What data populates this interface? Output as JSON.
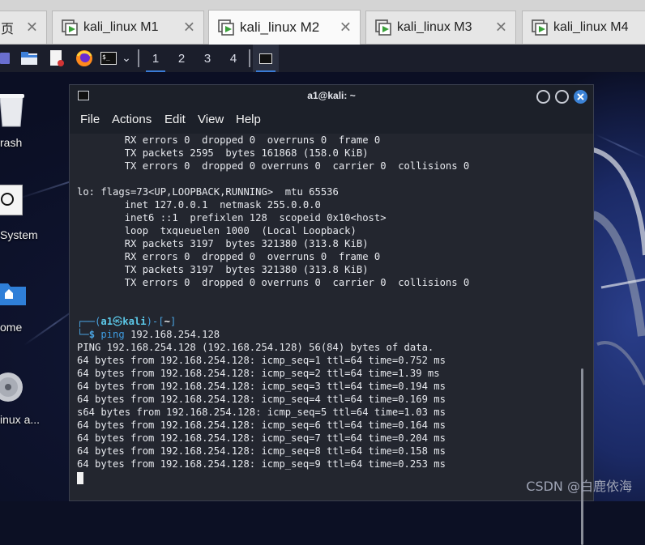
{
  "host_tabs": [
    {
      "label": "页",
      "close": "✕",
      "active": false
    },
    {
      "label": "kali_linux M1",
      "close": "✕",
      "active": false
    },
    {
      "label": "kali_linux M2",
      "close": "✕",
      "active": true
    },
    {
      "label": "kali_linux M3",
      "close": "✕",
      "active": false
    },
    {
      "label": "kali_linux M4",
      "close": "",
      "active": false
    }
  ],
  "taskbar": {
    "launchers": [
      "show-desktop-icon",
      "file-manager-icon",
      "text-editor-icon",
      "firefox-icon",
      "terminal-icon"
    ],
    "dropdown_glyph": "⌄",
    "workspaces": [
      "1",
      "2",
      "3",
      "4"
    ],
    "active_workspace": "1",
    "terminal_glyph": "$_"
  },
  "desktop_icons": [
    {
      "label": "rash",
      "icon": "trash-icon"
    },
    {
      "label": "System",
      "icon": "system-icon"
    },
    {
      "label": "ome",
      "icon": "home-folder-icon"
    },
    {
      "label": "inux a...",
      "icon": "disc-icon"
    }
  ],
  "terminal": {
    "title": "a1@kali: ~",
    "menu": [
      "File",
      "Actions",
      "Edit",
      "View",
      "Help"
    ],
    "lines_upper": [
      "        RX errors 0  dropped 0  overruns 0  frame 0",
      "        TX packets 2595  bytes 161868 (158.0 KiB)",
      "        TX errors 0  dropped 0 overruns 0  carrier 0  collisions 0",
      "",
      "lo: flags=73<UP,LOOPBACK,RUNNING>  mtu 65536",
      "        inet 127.0.0.1  netmask 255.0.0.0",
      "        inet6 ::1  prefixlen 128  scopeid 0x10<host>",
      "        loop  txqueuelen 1000  (Local Loopback)",
      "        RX packets 3197  bytes 321380 (313.8 KiB)",
      "        RX errors 0  dropped 0  overruns 0  frame 0",
      "        TX packets 3197  bytes 321380 (313.8 KiB)",
      "        TX errors 0  dropped 0 overruns 0  carrier 0  collisions 0"
    ],
    "prompt": {
      "corner_top": "┌──(",
      "user": "a1",
      "at": "㉿",
      "host": "kali",
      "mid": ")-[",
      "dir": "~",
      "end": "]",
      "corner_bottom": "└─",
      "dollar": "$",
      "command": "ping",
      "args": "192.168.254.128"
    },
    "ping_header": "PING 192.168.254.128 (192.168.254.128) 56(84) bytes of data.",
    "ping_lines": [
      "64 bytes from 192.168.254.128: icmp_seq=1 ttl=64 time=0.752 ms",
      "64 bytes from 192.168.254.128: icmp_seq=2 ttl=64 time=1.39 ms",
      "64 bytes from 192.168.254.128: icmp_seq=3 ttl=64 time=0.194 ms",
      "64 bytes from 192.168.254.128: icmp_seq=4 ttl=64 time=0.169 ms",
      "s64 bytes from 192.168.254.128: icmp_seq=5 ttl=64 time=1.03 ms",
      "64 bytes from 192.168.254.128: icmp_seq=6 ttl=64 time=0.164 ms",
      "64 bytes from 192.168.254.128: icmp_seq=7 ttl=64 time=0.204 ms",
      "64 bytes from 192.168.254.128: icmp_seq=8 ttl=64 time=0.158 ms",
      "64 bytes from 192.168.254.128: icmp_seq=9 ttl=64 time=0.253 ms"
    ]
  },
  "watermark": "CSDN @白鹿依海",
  "colors": {
    "prompt_blue": "#4aa3e0",
    "close_button_blue": "#3b82d6",
    "vm_icon_green": "#3aa13a"
  }
}
